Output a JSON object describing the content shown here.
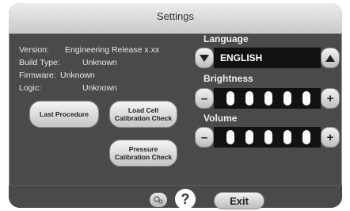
{
  "header": {
    "title": "Settings"
  },
  "info": {
    "version_label": "Version:",
    "version_value": "Engineering Release x.xx",
    "build_label": "Build Type:",
    "build_value": "Unknown",
    "firmware_label": "Firmware:",
    "firmware_value": "Unknown",
    "logic_label": "Logic:",
    "logic_value": "Unknown"
  },
  "buttons": {
    "last_procedure": "Last Procedure",
    "load_cell_calibration": "Load Cell Calibration Check",
    "pressure_calibration": "Pressure Calibration Check"
  },
  "language": {
    "label": "Language",
    "value": "ENGLISH"
  },
  "brightness": {
    "label": "Brightness",
    "level": 5,
    "max": 5,
    "minus": "–",
    "plus": "+"
  },
  "volume": {
    "label": "Volume",
    "level": 5,
    "max": 5,
    "minus": "–",
    "plus": "+"
  },
  "footer": {
    "help_label": "?",
    "exit_label": "Exit"
  }
}
